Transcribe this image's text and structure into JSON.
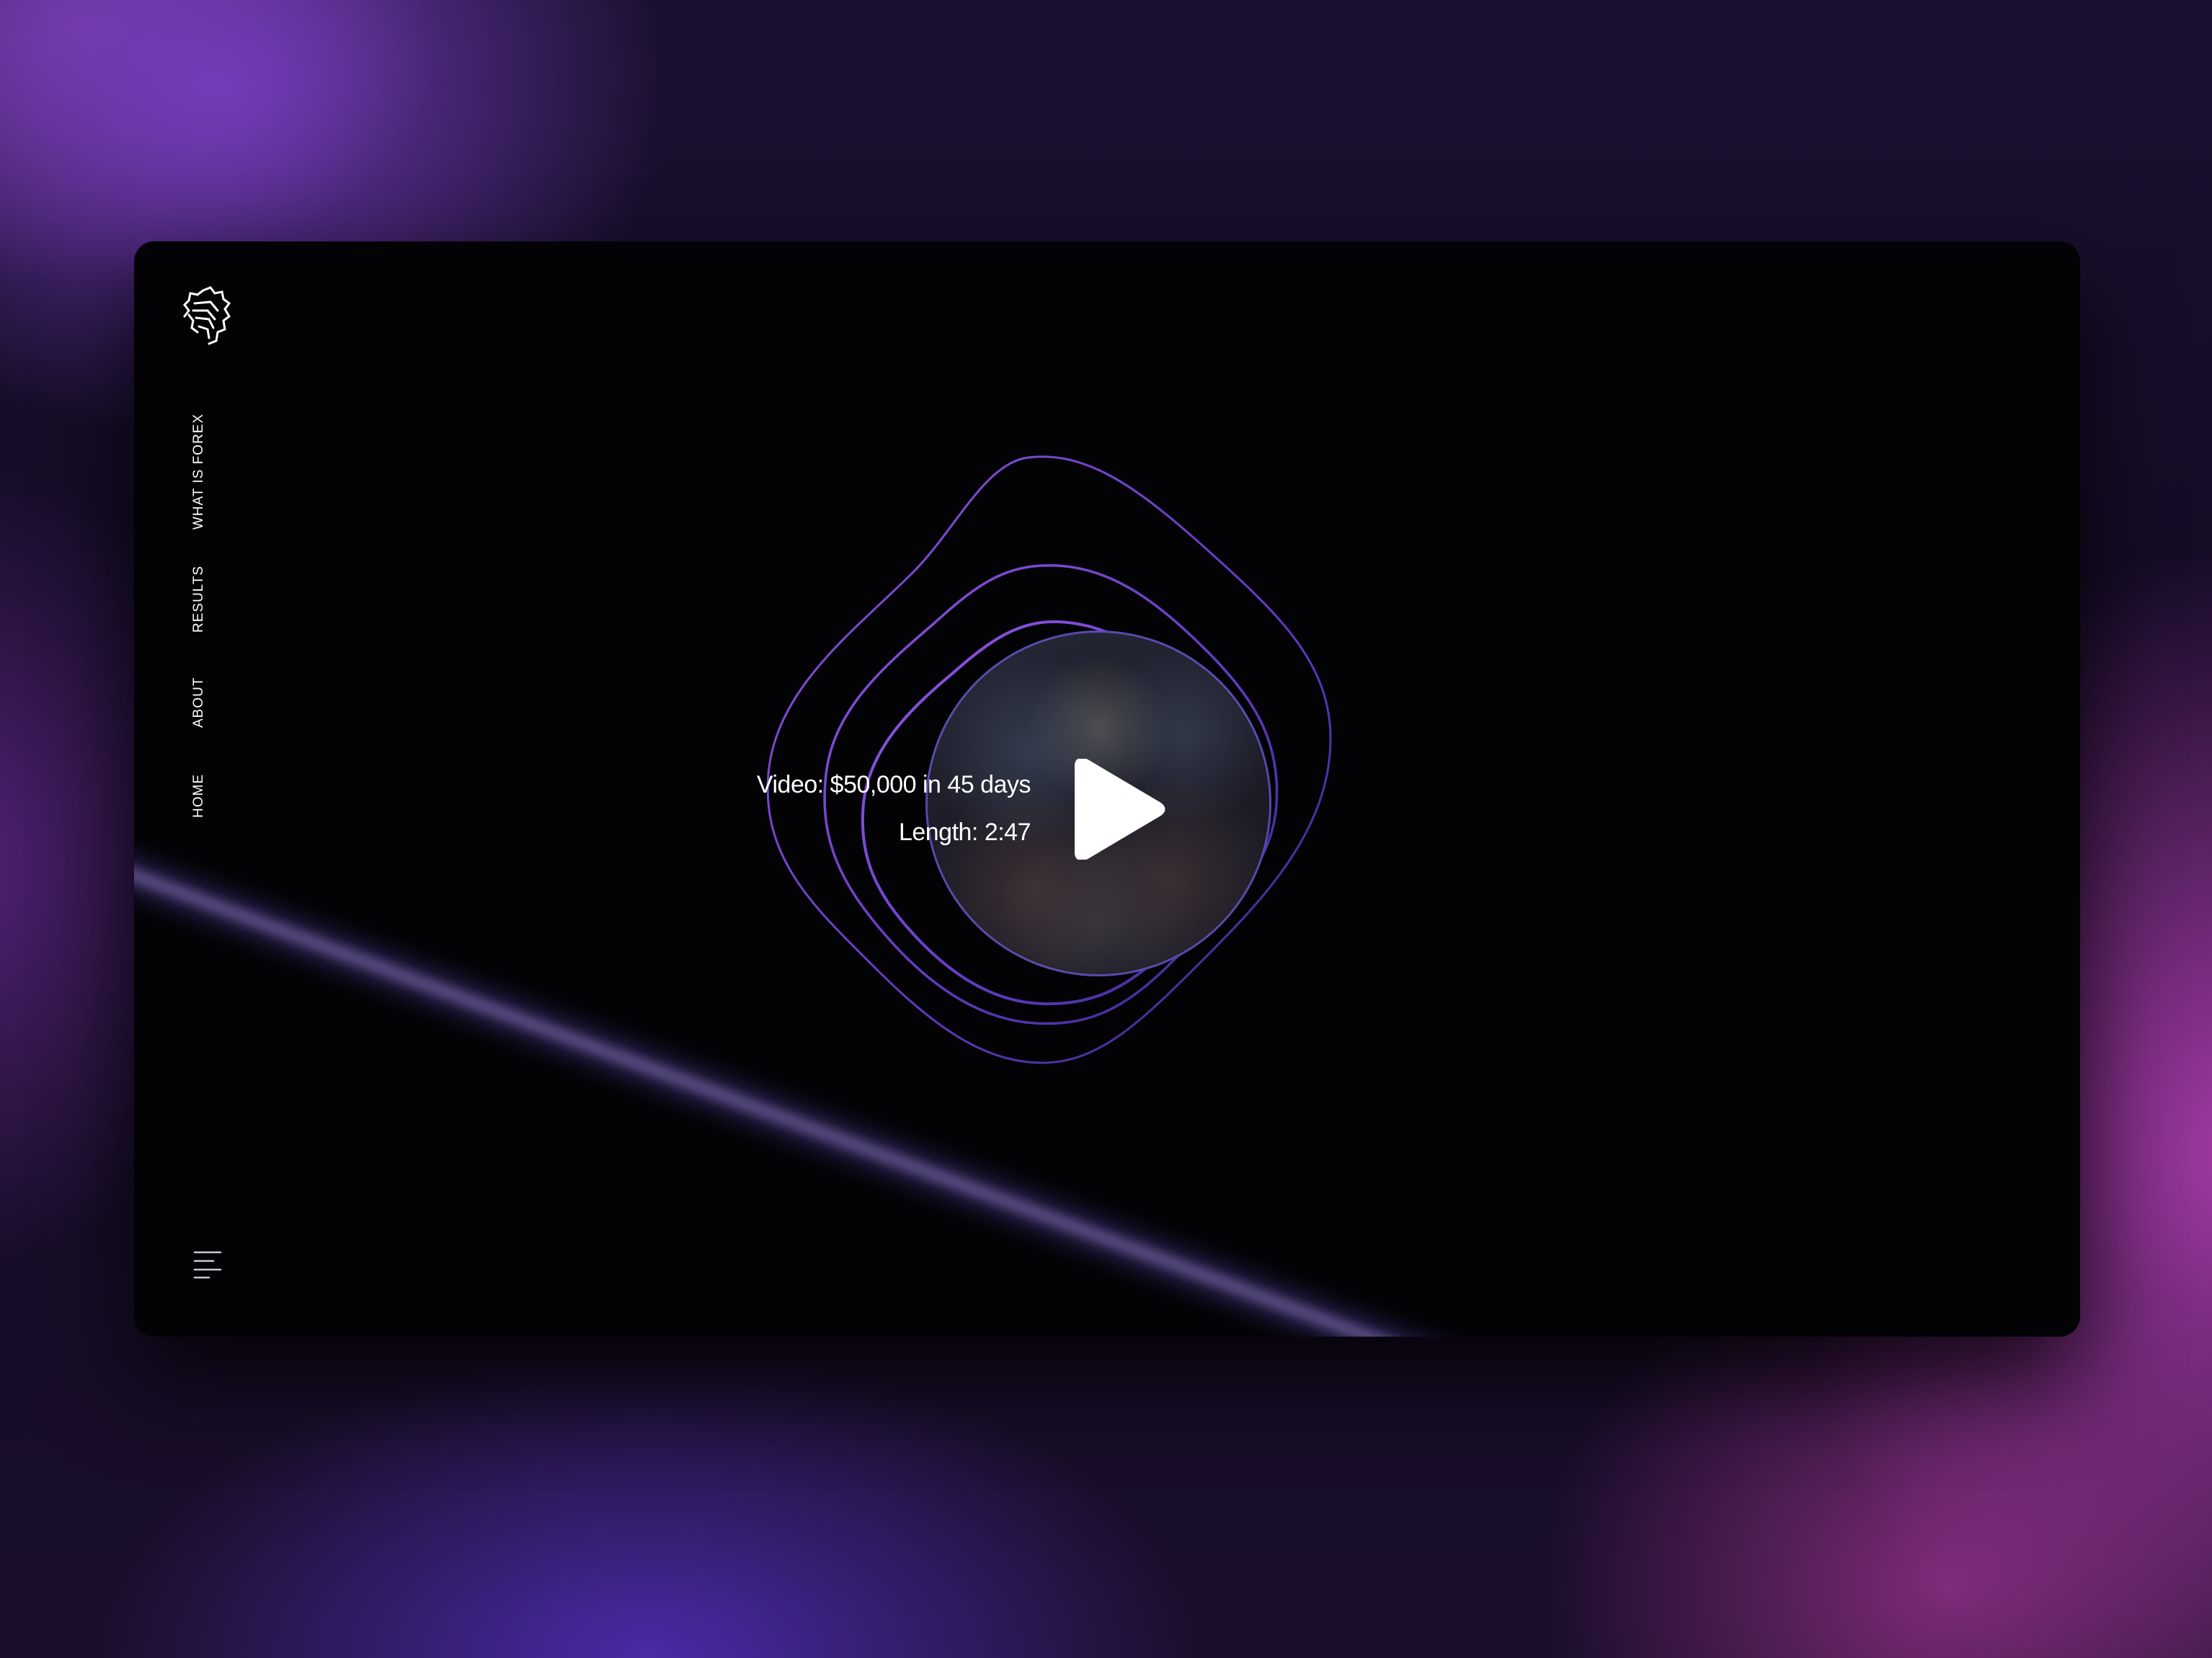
{
  "nav": {
    "items": [
      {
        "label": "HOME"
      },
      {
        "label": "ABOUT"
      },
      {
        "label": "RESULTS"
      },
      {
        "label": "WHAT IS FOREX"
      }
    ]
  },
  "video": {
    "title": "Video: $50,000 in 45 days",
    "length": "Length: 2:47"
  },
  "icons": {
    "logo": "lion-head-logo",
    "play": "play-icon",
    "menu": "hamburger-menu-icon"
  },
  "colors": {
    "card_background": "#030306",
    "accent_ring": "#7b4fe0",
    "text": "#ffffff"
  }
}
